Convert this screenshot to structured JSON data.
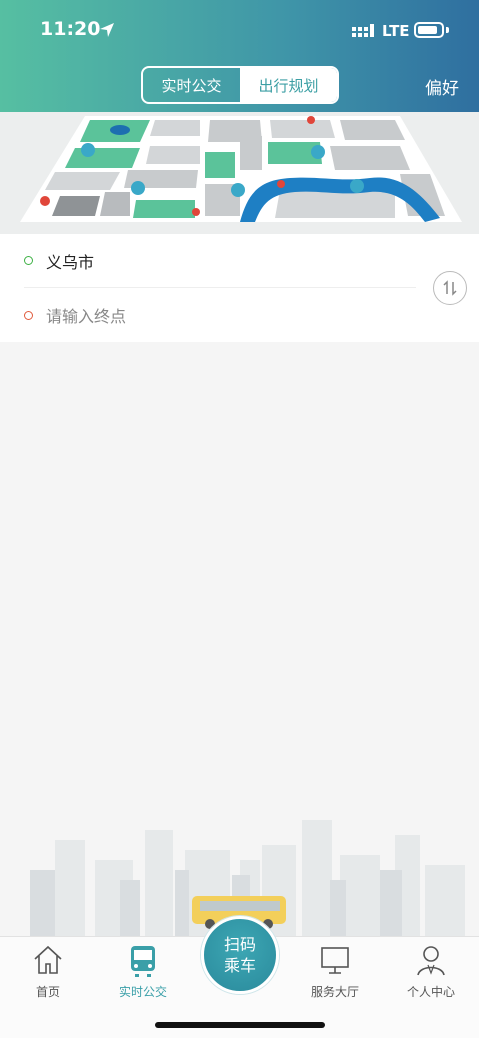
{
  "status_bar": {
    "time": "11:20",
    "network": "LTE"
  },
  "header": {
    "tabs": [
      {
        "label": "实时公交",
        "active": false
      },
      {
        "label": "出行规划",
        "active": true
      }
    ],
    "preferences_label": "偏好"
  },
  "route": {
    "origin": "义乌市",
    "destination_placeholder": "请输入终点"
  },
  "scan_button": {
    "line1": "扫码",
    "line2": "乘车"
  },
  "tabbar": {
    "items": [
      {
        "label": "首页",
        "icon": "home-icon",
        "active": false
      },
      {
        "label": "实时公交",
        "icon": "bus-icon",
        "active": true
      },
      {
        "label": "服务大厅",
        "icon": "monitor-icon",
        "active": false
      },
      {
        "label": "个人中心",
        "icon": "person-icon",
        "active": false
      }
    ]
  },
  "colors": {
    "accent": "#3a9fa8",
    "header_start": "#56bfa2",
    "header_end": "#2f6fa0",
    "start_dot": "#3cb043",
    "end_dot": "#e05a3c"
  }
}
